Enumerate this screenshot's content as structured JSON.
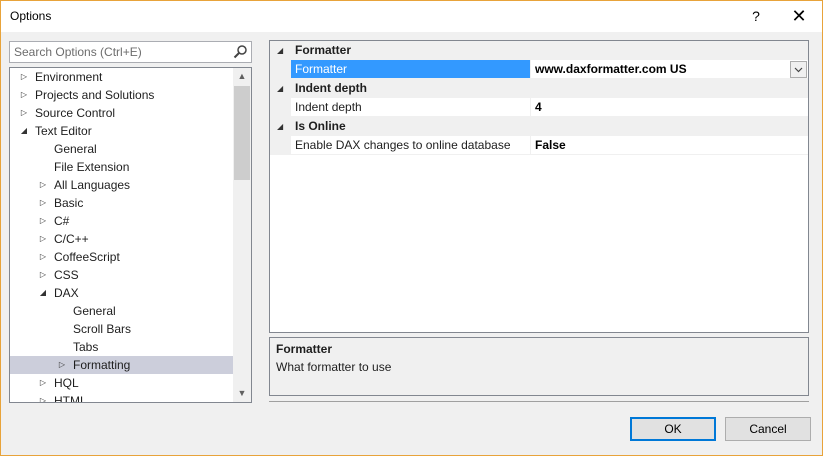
{
  "window": {
    "title": "Options",
    "help_label": "?",
    "close_label": "✕"
  },
  "search": {
    "placeholder": "Search Options (Ctrl+E)"
  },
  "tree": {
    "items": [
      {
        "label": "Environment",
        "level": 0,
        "state": "collapsed"
      },
      {
        "label": "Projects and Solutions",
        "level": 0,
        "state": "collapsed"
      },
      {
        "label": "Source Control",
        "level": 0,
        "state": "collapsed"
      },
      {
        "label": "Text Editor",
        "level": 0,
        "state": "expanded"
      },
      {
        "label": "General",
        "level": 1,
        "state": "leaf"
      },
      {
        "label": "File Extension",
        "level": 1,
        "state": "leaf"
      },
      {
        "label": "All Languages",
        "level": 1,
        "state": "collapsed"
      },
      {
        "label": "Basic",
        "level": 1,
        "state": "collapsed"
      },
      {
        "label": "C#",
        "level": 1,
        "state": "collapsed"
      },
      {
        "label": "C/C++",
        "level": 1,
        "state": "collapsed"
      },
      {
        "label": "CoffeeScript",
        "level": 1,
        "state": "collapsed"
      },
      {
        "label": "CSS",
        "level": 1,
        "state": "collapsed"
      },
      {
        "label": "DAX",
        "level": 1,
        "state": "expanded"
      },
      {
        "label": "General",
        "level": 2,
        "state": "leaf"
      },
      {
        "label": "Scroll Bars",
        "level": 2,
        "state": "leaf"
      },
      {
        "label": "Tabs",
        "level": 2,
        "state": "leaf"
      },
      {
        "label": "Formatting",
        "level": 2,
        "state": "collapsed",
        "selected": true
      },
      {
        "label": "HQL",
        "level": 1,
        "state": "collapsed"
      },
      {
        "label": "HTML",
        "level": 1,
        "state": "collapsed"
      }
    ]
  },
  "grid": {
    "categories": [
      {
        "label": "Formatter",
        "props": [
          {
            "name": "Formatter",
            "value": "www.daxformatter.com US",
            "active": true,
            "dropdown": true
          }
        ]
      },
      {
        "label": "Indent depth",
        "props": [
          {
            "name": "Indent depth",
            "value": "4"
          }
        ]
      },
      {
        "label": "Is Online",
        "props": [
          {
            "name": "Enable DAX changes to online database",
            "value": "False"
          }
        ]
      }
    ]
  },
  "description": {
    "title": "Formatter",
    "text": "What formatter to use"
  },
  "buttons": {
    "ok_label": "OK",
    "cancel_label": "Cancel"
  },
  "colors": {
    "selection": "#3399ff",
    "tree_selected": "#cccedb",
    "primary_border": "#0078d7"
  }
}
